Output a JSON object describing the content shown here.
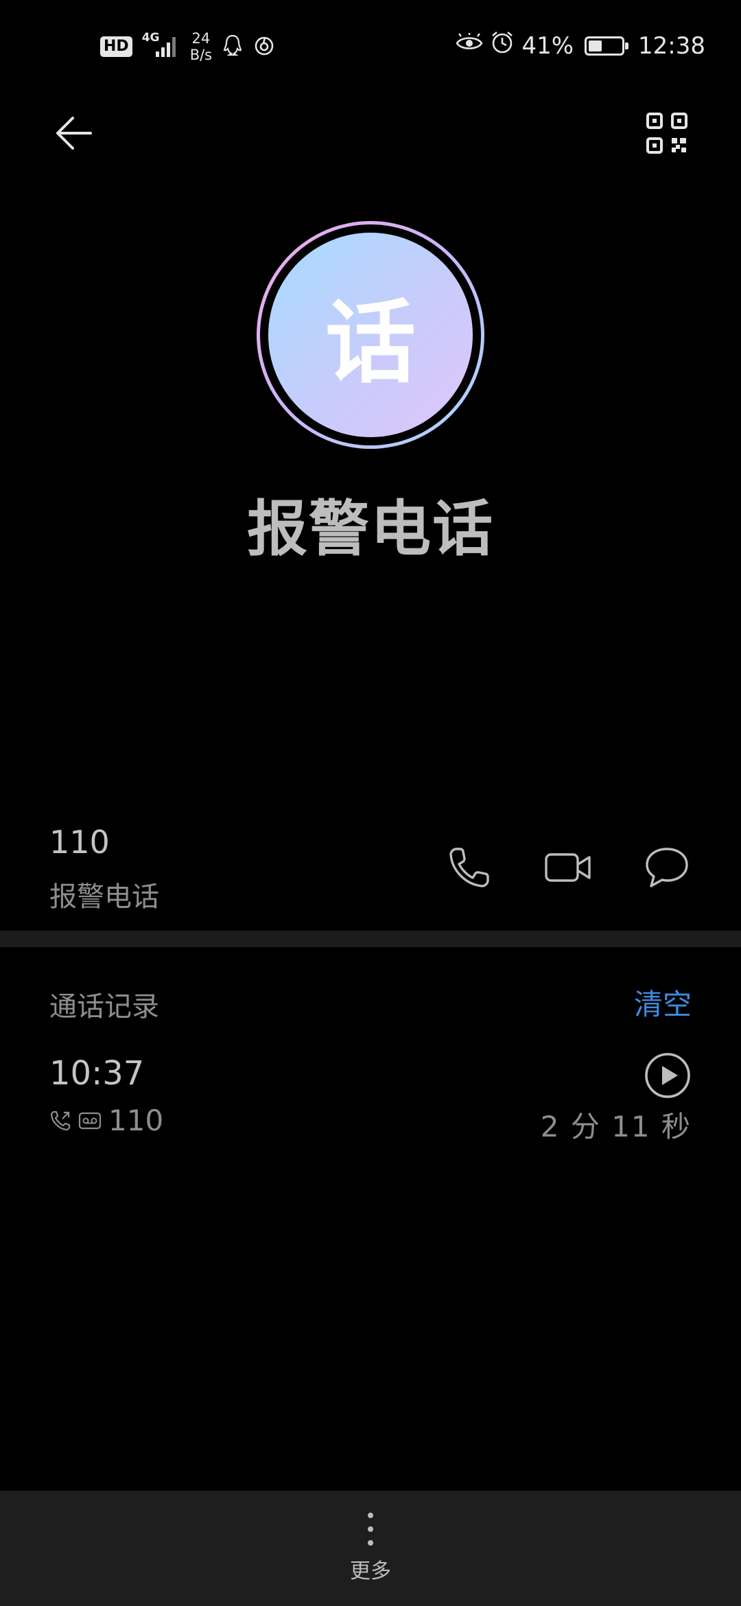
{
  "status_bar": {
    "hd": "HD",
    "network": "4G",
    "net_speed_value": "24",
    "net_speed_unit": "B/s",
    "battery_percent": "41%",
    "battery_level": 0.41,
    "time": "12:38"
  },
  "contact": {
    "avatar_char": "话",
    "name": "报警电话"
  },
  "number_row": {
    "number": "110",
    "label": "报警电话"
  },
  "call_log": {
    "title": "通话记录",
    "clear_label": "清空",
    "entries": [
      {
        "time": "10:37",
        "number": "110",
        "duration": "2 分 11 秒"
      }
    ]
  },
  "bottom_bar": {
    "more_label": "更多"
  },
  "colors": {
    "accent": "#3f8ae0",
    "background": "#000000"
  }
}
